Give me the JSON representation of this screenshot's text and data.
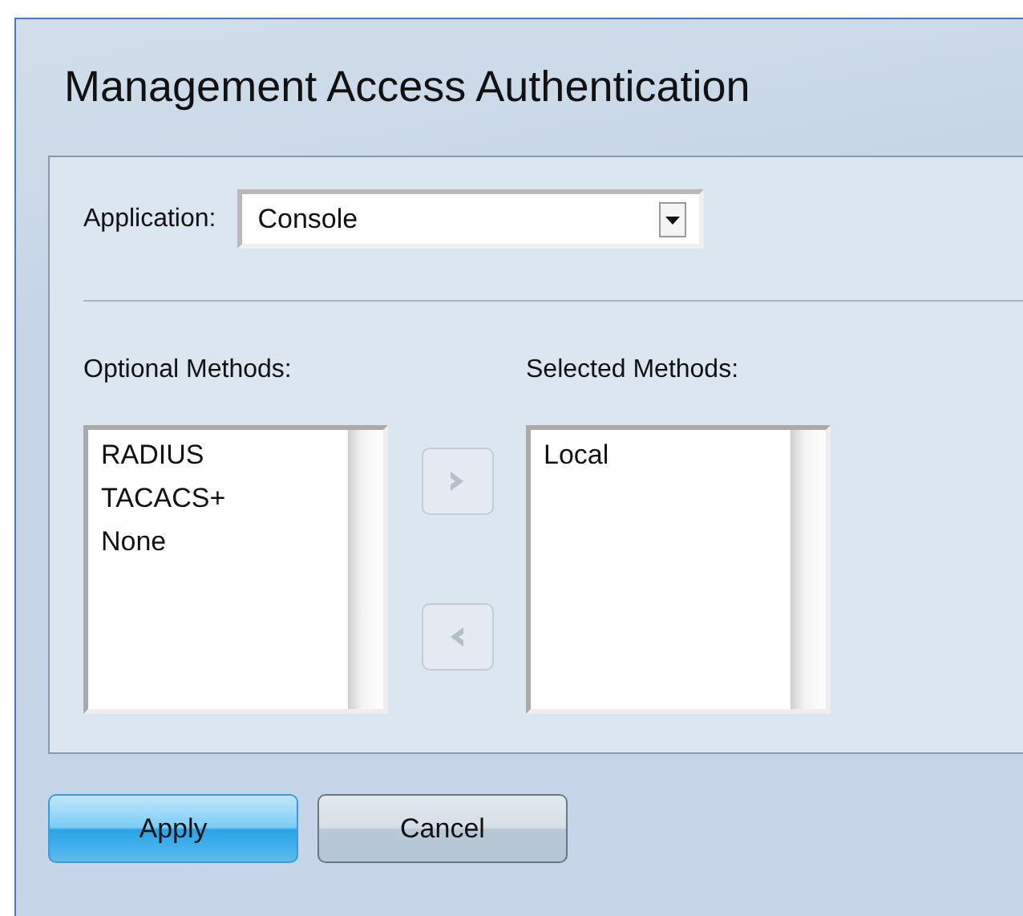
{
  "title": "Management Access Authentication",
  "application": {
    "label": "Application:",
    "value": "Console"
  },
  "optional_methods": {
    "label": "Optional Methods:",
    "items": [
      "RADIUS",
      "TACACS+",
      "None"
    ]
  },
  "move_buttons": [
    {
      "kind": "add",
      "disabled": true
    },
    {
      "kind": "remove",
      "disabled": true
    }
  ],
  "selected_methods": {
    "label": "Selected Methods:",
    "items": [
      "Local"
    ]
  },
  "buttons": [
    {
      "label": "Apply",
      "kind": "primary"
    },
    {
      "label": "Cancel",
      "kind": "secondary"
    }
  ]
}
